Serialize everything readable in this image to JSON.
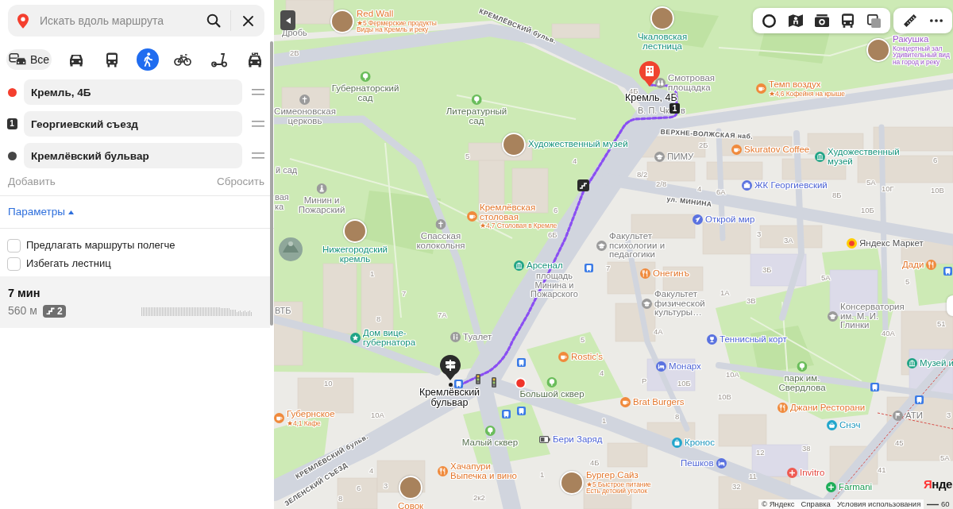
{
  "search": {
    "placeholder": "Искать вдоль маршрута"
  },
  "modes": [
    {
      "kind": "all",
      "label": "Все",
      "selected": false
    },
    {
      "kind": "car",
      "selected": false
    },
    {
      "kind": "bus",
      "selected": false
    },
    {
      "kind": "walk",
      "selected": true
    },
    {
      "kind": "bike",
      "selected": false
    },
    {
      "kind": "scooter",
      "selected": false
    },
    {
      "kind": "taxi",
      "selected": false
    }
  ],
  "waypoints": [
    {
      "kind": "start",
      "value": "Кремль, 4Б"
    },
    {
      "kind": "via",
      "marker": "1",
      "value": "Георгиевский съезд"
    },
    {
      "kind": "end",
      "value": "Кремлёвский бульвар"
    }
  ],
  "actions": {
    "add": "Добавить",
    "reset": "Сбросить"
  },
  "parameters": {
    "label": "Параметры",
    "expanded": true,
    "options": [
      {
        "label": "Предлагать маршруты полегче",
        "checked": false
      },
      {
        "label": "Избегать лестниц",
        "checked": false
      }
    ]
  },
  "route": {
    "selected": true,
    "time": "7 мин",
    "distance": "560 м",
    "stairs": "2"
  },
  "map": {
    "via_badge": "1",
    "labels": [
      {
        "kind": "place",
        "lines": [
          "Дробь"
        ]
      },
      {
        "kind": "eatery",
        "lines": [
          "Red Wall"
        ],
        "details": [
          "★5 Фермерские продукты",
          "Виды на Кремль и реку"
        ]
      },
      {
        "kind": "sight",
        "lines": [
          "Чкаловская",
          "лестница"
        ]
      },
      {
        "kind": "venue",
        "lines": [
          "Ракушка"
        ],
        "details": [
          "Концертный зал",
          "Удивительный вид",
          "на город и реку"
        ]
      },
      {
        "kind": "church",
        "lines": [
          "Симеоновская",
          "церковь"
        ]
      },
      {
        "kind": "park",
        "lines": [
          "Губернаторский",
          "сад"
        ]
      },
      {
        "kind": "park",
        "lines": [
          "Литературный",
          "сад"
        ]
      },
      {
        "kind": "endpoint",
        "lines": [
          "Кремль, 4Б"
        ]
      },
      {
        "kind": "place",
        "lines": [
          "В. П. Чк"
        ]
      },
      {
        "kind": "viewpoint",
        "lines": [
          "Смотровая",
          "площадка"
        ]
      },
      {
        "kind": "place",
        "lines": [
          "в"
        ]
      },
      {
        "kind": "cafe",
        "lines": [
          "Темп воздух"
        ],
        "details": [
          "★4,6 Кофейня на крыше"
        ]
      },
      {
        "kind": "sight",
        "lines": [
          "Художественный музей"
        ]
      },
      {
        "kind": "university",
        "lines": [
          "ПИМУ"
        ]
      },
      {
        "kind": "cafe",
        "lines": [
          "Skuratov Coffee"
        ]
      },
      {
        "kind": "museum",
        "lines": [
          "Художественный",
          "музей"
        ]
      },
      {
        "kind": "place",
        "lines": [
          "й сад"
        ]
      },
      {
        "kind": "place",
        "lines": [
          "вая",
          "ка"
        ]
      },
      {
        "kind": "monument",
        "lines": [
          "Минин и",
          "Пожарский"
        ]
      },
      {
        "kind": "cafe",
        "lines": [
          "Кремлёвская",
          "столовая"
        ],
        "details": [
          "★4,7 Столовая в Кремле"
        ]
      },
      {
        "kind": "travel",
        "lines": [
          "Открой мир"
        ]
      },
      {
        "kind": "housing",
        "lines": [
          "ЖК Георгиевский"
        ]
      },
      {
        "kind": "sight",
        "lines": [
          "Нижегородский",
          "кремль"
        ]
      },
      {
        "kind": "church",
        "lines": [
          "Спасская",
          "колокольня"
        ]
      },
      {
        "kind": "university",
        "lines": [
          "Факультет",
          "психологии и",
          "педагогики"
        ]
      },
      {
        "kind": "market",
        "lines": [
          "Яндекс Маркет"
        ]
      },
      {
        "kind": "place",
        "lines": [
          "ВТБ"
        ]
      },
      {
        "kind": "museum",
        "lines": [
          "Арсенал"
        ]
      },
      {
        "kind": "place",
        "lines": [
          "площадь",
          "Минина и",
          "Пожарского"
        ]
      },
      {
        "kind": "restaurant",
        "lines": [
          "Онегинъ"
        ]
      },
      {
        "kind": "university",
        "lines": [
          "Факультет",
          "физической",
          "культуры…"
        ]
      },
      {
        "kind": "university",
        "lines": [
          "Консерватория",
          "им. М. И.",
          "Глинки"
        ]
      },
      {
        "kind": "restaurant",
        "lines": [
          "Дади"
        ]
      },
      {
        "kind": "memorial",
        "lines": [
          "Дом вице-",
          "губернатора"
        ]
      },
      {
        "kind": "toilet",
        "lines": [
          "Туалет"
        ]
      },
      {
        "kind": "sport",
        "lines": [
          "Теннисный корт"
        ]
      },
      {
        "kind": "cafe",
        "lines": [
          "Rostic's"
        ]
      },
      {
        "kind": "hotel",
        "lines": [
          "Монарх"
        ]
      },
      {
        "kind": "park",
        "lines": [
          "парк им.",
          "Свердлова"
        ]
      },
      {
        "kind": "museum",
        "lines": [
          "Музей и"
        ]
      },
      {
        "kind": "cafe",
        "lines": [
          "Губернское"
        ],
        "details": [
          "★4,1 Кафе"
        ]
      },
      {
        "kind": "endpoint",
        "lines": [
          "Кремлёвский",
          "бульвар"
        ]
      },
      {
        "kind": "park",
        "lines": [
          "Большой сквер"
        ]
      },
      {
        "kind": "cafe",
        "lines": [
          "Brat Burgers"
        ]
      },
      {
        "kind": "restaurant",
        "lines": [
          "Джани Ресторани"
        ]
      },
      {
        "kind": "office",
        "lines": [
          "АТИ"
        ]
      },
      {
        "kind": "park",
        "lines": [
          "Малый сквер"
        ]
      },
      {
        "kind": "charging",
        "lines": [
          "Бери Заряд"
        ]
      },
      {
        "kind": "boutique",
        "lines": [
          "Кронос"
        ]
      },
      {
        "kind": "grocery",
        "lines": [
          "Снэч"
        ]
      },
      {
        "kind": "eatery",
        "lines": [
          "Совок"
        ]
      },
      {
        "kind": "restaurant",
        "lines": [
          "Хачапури",
          "Выпечка и вино"
        ]
      },
      {
        "kind": "eatery",
        "lines": [
          "Бургер Сайз"
        ],
        "details": [
          "★5 Быстрое питание",
          "Есть детский уголок"
        ]
      },
      {
        "kind": "hotel",
        "lines": [
          "Пешков"
        ]
      },
      {
        "kind": "clinic",
        "lines": [
          "Invitro"
        ]
      },
      {
        "kind": "pharmacy",
        "lines": [
          "Farmani"
        ]
      }
    ],
    "house_numbers": [
      "2В",
      "4Б",
      "2Б",
      "5",
      "4",
      "6",
      "8/2",
      "2/8",
      "4",
      "6А",
      "8Б",
      "5А",
      "10Г",
      "10В",
      "6",
      "10Б",
      "6Б",
      "3",
      "3А",
      "1",
      "7",
      "3Б",
      "5А",
      "5",
      "7",
      "1А",
      "3В",
      "8",
      "7А",
      "51",
      "5",
      "4А",
      "40А",
      "10",
      "4",
      "P",
      "10Б",
      "10А",
      "10В",
      "10А",
      "1",
      "8",
      "3",
      "12",
      "38",
      "45",
      "5А",
      "4",
      "1",
      "4Б",
      "11",
      "41",
      "6",
      "3",
      "32",
      "8",
      "2к2"
    ],
    "streets": [
      "КРЕМЛЁВСКИЙ бульв.",
      "ВЕРХНЕ-ВОЛЖСКАЯ наб.",
      "ул. МИНИНА",
      "ЗЕЛЕНСКИЙ СЪЕЗД",
      "КРЕМЛЁВСКИЙ бульв."
    ],
    "attribution": {
      "copyright": "© Яндекс",
      "links": [
        "Справка",
        "Условия использования"
      ]
    },
    "scale": "60",
    "logo": "Янде"
  }
}
